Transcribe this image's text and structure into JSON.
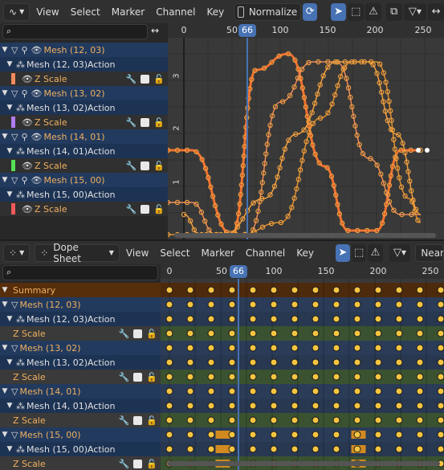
{
  "graph_editor": {
    "header": {
      "menus": [
        "View",
        "Select",
        "Marker",
        "Channel",
        "Key"
      ],
      "normalize_label": "Normalize",
      "editor_icon": "graph-editor-icon"
    },
    "ruler": {
      "ticks": [
        "0",
        "50",
        "100",
        "150",
        "200",
        "250"
      ],
      "current_frame": "66"
    },
    "y_labels": [
      "3",
      "2",
      "1"
    ],
    "channels": [
      {
        "object": "Mesh (12, 03)",
        "action": "Mesh (12, 03)Action",
        "channel": "Z Scale",
        "color": "#f08a5c"
      },
      {
        "object": "Mesh (13, 02)",
        "action": "Mesh (13, 02)Action",
        "channel": "Z Scale",
        "color": "#b07cf0"
      },
      {
        "object": "Mesh (14, 01)",
        "action": "Mesh (14, 01)Action",
        "channel": "Z Scale",
        "color": "#56e056"
      },
      {
        "object": "Mesh (15, 00)",
        "action": "Mesh (15, 00)Action",
        "channel": "Z Scale",
        "color": "#f05a5a"
      }
    ]
  },
  "dope_sheet": {
    "header": {
      "mode": "Dope Sheet",
      "menus": [
        "View",
        "Select",
        "Marker",
        "Channel",
        "Key"
      ],
      "nearest_label": "Neare"
    },
    "ruler": {
      "ticks": [
        "0",
        "50",
        "100",
        "150",
        "200",
        "250"
      ],
      "current_frame": "66"
    },
    "summary_label": "Summary",
    "channels": [
      {
        "object": "Mesh (12, 03)",
        "action": "Mesh (12, 03)Action",
        "channel": "Z Scale"
      },
      {
        "object": "Mesh (13, 02)",
        "action": "Mesh (13, 02)Action",
        "channel": "Z Scale"
      },
      {
        "object": "Mesh (14, 01)",
        "action": "Mesh (14, 01)Action",
        "channel": "Z Scale"
      },
      {
        "object": "Mesh (15, 00)",
        "action": "Mesh (15, 00)Action",
        "channel": "Z Scale"
      }
    ],
    "key_frames": [
      0,
      20,
      40,
      60,
      80,
      100,
      120,
      140,
      160,
      180,
      200,
      220,
      240,
      260
    ]
  }
}
